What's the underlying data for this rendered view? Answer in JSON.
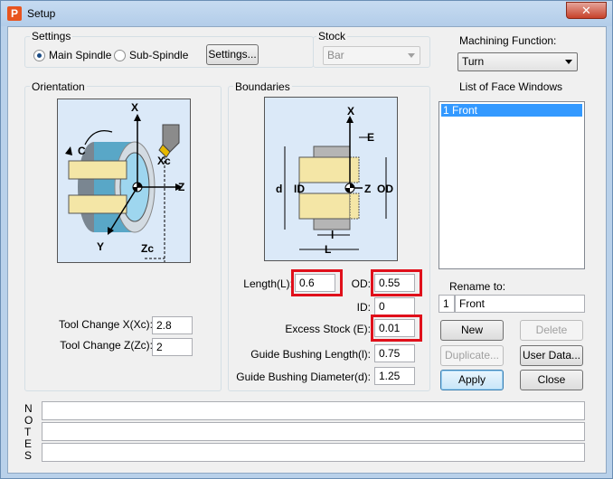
{
  "window": {
    "title": "Setup",
    "close_glyph": "✕"
  },
  "settings": {
    "group_label": "Settings",
    "main_spindle_label": "Main Spindle",
    "sub_spindle_label": "Sub-Spindle",
    "main_spindle_selected": true,
    "settings_button": "Settings..."
  },
  "stock": {
    "group_label": "Stock",
    "value": "Bar"
  },
  "machining": {
    "label": "Machining Function:",
    "value": "Turn"
  },
  "orientation": {
    "group_label": "Orientation",
    "diagram_labels": {
      "c": "C",
      "x": "X",
      "xc": "Xc",
      "z": "Z",
      "y": "Y",
      "zc": "Zc"
    },
    "tool_change_x_label": "Tool Change X(Xc):",
    "tool_change_x_value": "2.8",
    "tool_change_z_label": "Tool Change Z(Zc):",
    "tool_change_z_value": "2"
  },
  "boundaries": {
    "group_label": "Boundaries",
    "diagram_labels": {
      "x": "X",
      "e": "E",
      "d": "d",
      "id": "ID",
      "z": "Z",
      "od": "OD",
      "l_small": "l",
      "l": "L"
    },
    "length_label": "Length(L):",
    "length_value": "0.6",
    "od_label": "OD:",
    "od_value": "0.55",
    "id_label": "ID:",
    "id_value": "0",
    "excess_stock_label": "Excess Stock (E):",
    "excess_stock_value": "0.01",
    "guide_length_label": "Guide Bushing Length(l):",
    "guide_length_value": "0.75",
    "guide_diameter_label": "Guide Bushing Diameter(d):",
    "guide_diameter_value": "1.25"
  },
  "face_windows": {
    "label": "List of Face Windows",
    "items": [
      "1 Front"
    ]
  },
  "rename": {
    "label": "Rename to:",
    "number": "1",
    "name": "Front"
  },
  "buttons": {
    "new": "New",
    "delete": "Delete",
    "duplicate": "Duplicate...",
    "user_data": "User Data...",
    "apply": "Apply",
    "close": "Close"
  },
  "notes": {
    "letters": [
      "N",
      "O",
      "T",
      "E",
      "S"
    ]
  }
}
